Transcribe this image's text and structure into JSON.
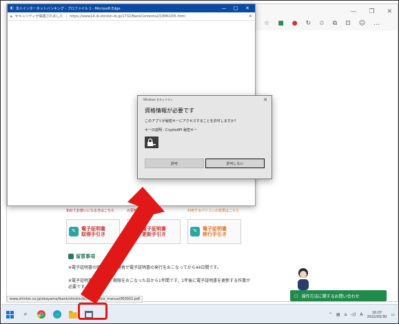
{
  "popup": {
    "title": "法人インターネットバンキング - プロファイル 1 - Microsoft Edge",
    "security_warning": "セキュリティが保護されました",
    "url": "https://www14.ib.shinkin-ib.jp/1732/BankContents2/C8MU205.html"
  },
  "dialog": {
    "header": "Windows セキュリティ",
    "title": "資格情報が必要です",
    "message": "このアプリが秘密キーにアクセスすることを許可しますか?",
    "key_description": "キーの説明 : CryptoAPI 秘密キー",
    "allow_label": "許可",
    "deny_label": "許可しない"
  },
  "page": {
    "cert_subtitles": [
      "初めてお使いになる方はこちら",
      "の更新はこちら",
      "利用するパソコンの変更はこちら"
    ],
    "cert_cards": [
      {
        "line1": "電子証明書",
        "line2": "取得手引き"
      },
      {
        "line1": "電子証明書",
        "line2": "更新手引き"
      },
      {
        "line1": "電子証明書",
        "line2": "移行手引き"
      }
    ],
    "notes_heading": "留意事項",
    "notes": [
      "※電子証明書の取得は、管理者が電子証明書の発行をおこなってから44日間です。",
      "※電子証明書の更新は、期限をおこなった日から1年間です。1年後に電子証明書を更新する作業が必要です。"
    ],
    "status_url": "www.shinkin.co.jp/okayama/ibank/shinkin/b/chatbot/biz_manual/f00002.pdf",
    "chat_text": "操作方法に関するお問い合わせ"
  },
  "taskbar": {
    "time": "16:07",
    "date": "2022/05/30",
    "ime": "A"
  },
  "colors": {
    "popup_titlebar": "#0a4aa6",
    "arrow": "#e01818",
    "chat": "#1f8a4a"
  }
}
